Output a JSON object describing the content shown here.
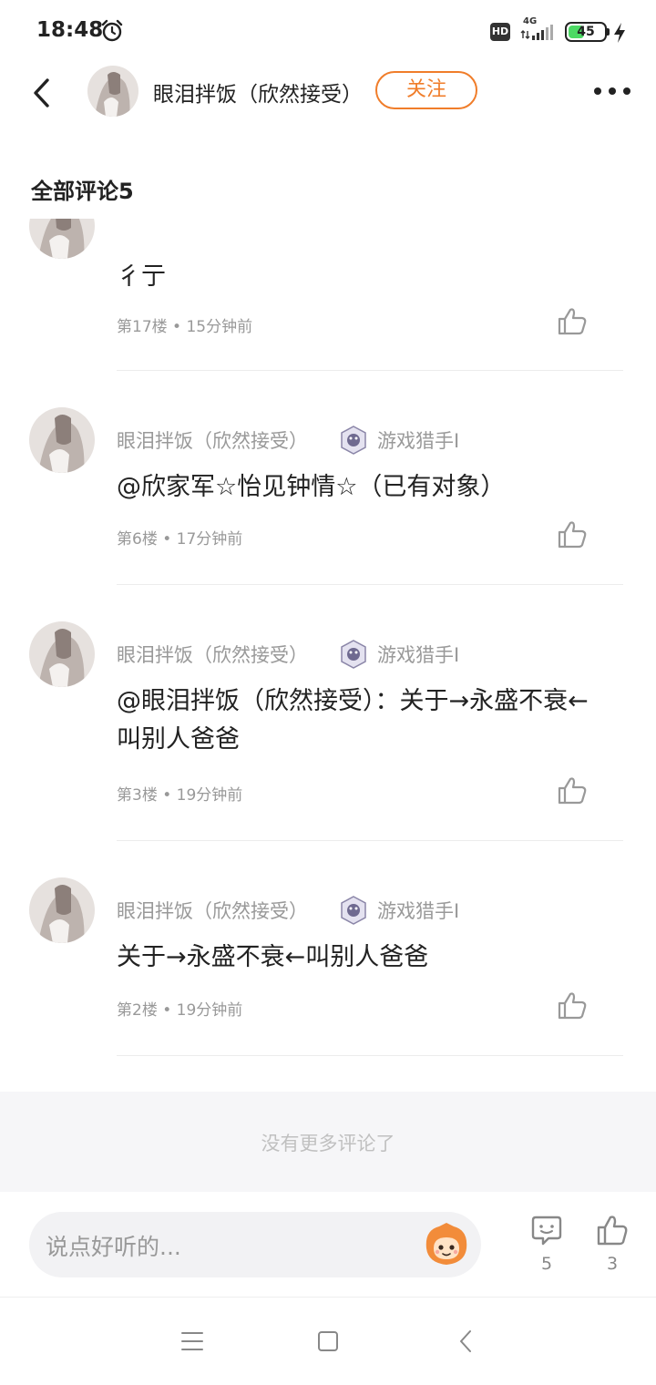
{
  "status_bar": {
    "time": "18:48",
    "hd_label": "HD",
    "network_label": "4G",
    "battery_percent": 45,
    "icons": [
      "alarm-icon",
      "signal-icon",
      "battery-icon",
      "charge-icon"
    ]
  },
  "header": {
    "username": "眼泪拌饭（欣然接受）",
    "follow_label": "关注",
    "icons": [
      "back-icon",
      "more-icon"
    ]
  },
  "section": {
    "title": "全部评论5"
  },
  "comments": [
    {
      "name": "",
      "badge": "",
      "text": "彳亍",
      "floor": "第17楼",
      "time": "15分钟前"
    },
    {
      "name": "眼泪拌饭（欣然接受）",
      "badge": "游戏猎手I",
      "text": "@欣家军☆怡见钟情☆（已有对象）",
      "floor": "第6楼",
      "time": "17分钟前"
    },
    {
      "name": "眼泪拌饭（欣然接受）",
      "badge": "游戏猎手I",
      "text": "@眼泪拌饭（欣然接受）：关于→永盛不衰←叫别人爸爸",
      "floor": "第3楼",
      "time": "19分钟前"
    },
    {
      "name": "眼泪拌饭（欣然接受）",
      "badge": "游戏猎手I",
      "text": "关于→永盛不衰←叫别人爸爸",
      "floor": "第2楼",
      "time": "19分钟前"
    }
  ],
  "footer": {
    "no_more": "没有更多评论了"
  },
  "input_bar": {
    "placeholder": "说点好听的...",
    "comment_count": "5",
    "like_count": "3"
  },
  "colors": {
    "accent": "#f07d2a",
    "battery": "#4cd964",
    "muted_text": "#999999"
  }
}
